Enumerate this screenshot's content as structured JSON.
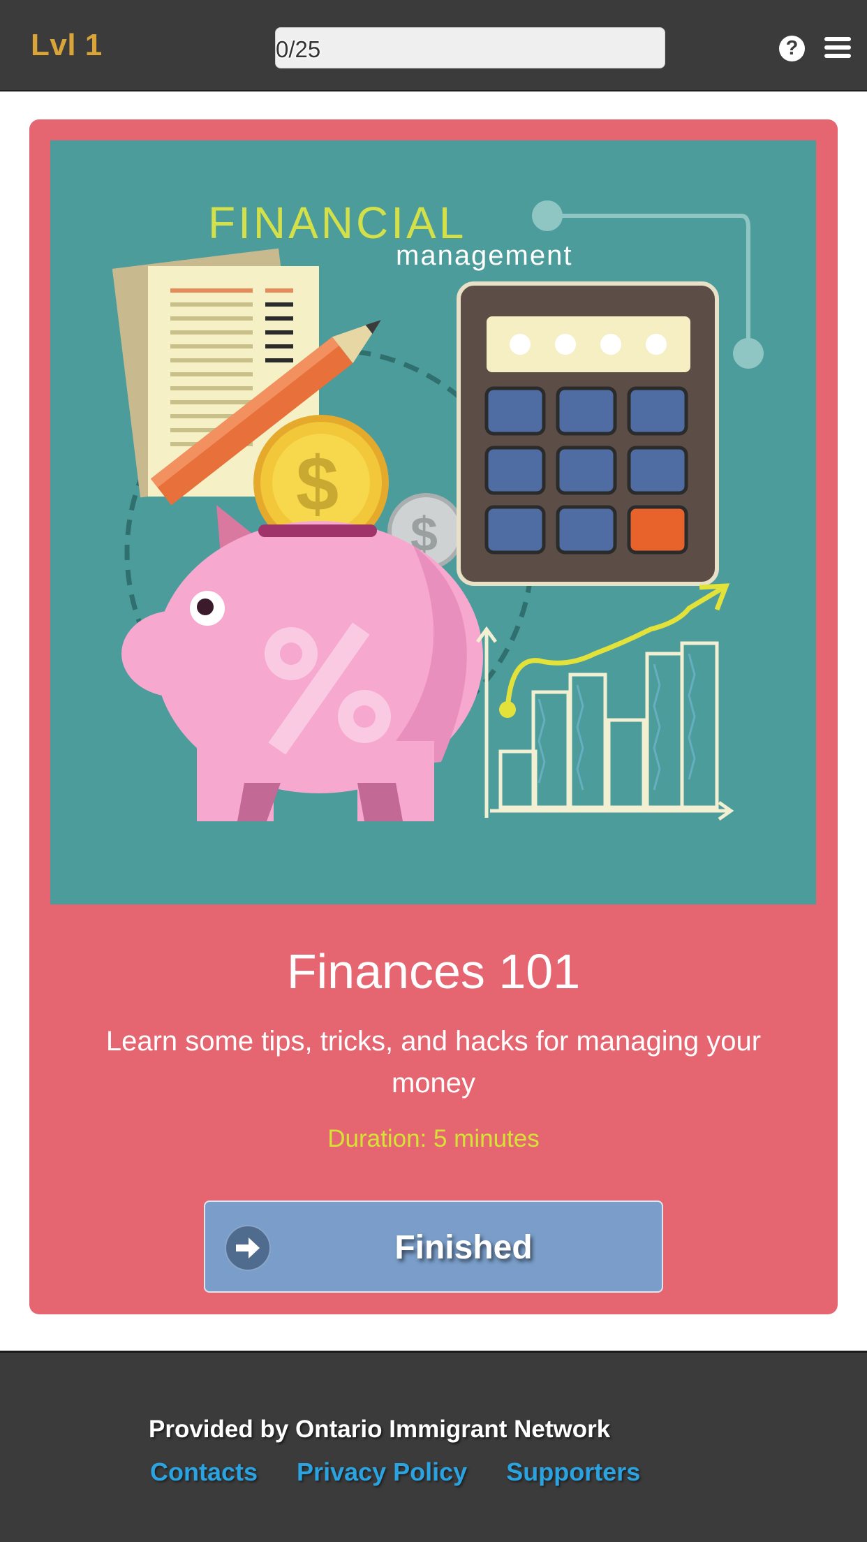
{
  "header": {
    "level_label": "Lvl 1",
    "progress_text": "0/25",
    "progress_fraction": 0.0,
    "help_icon": "question-circle-icon",
    "menu_icon": "hamburger-menu-icon"
  },
  "card": {
    "illustration": {
      "heading": "FINANCIAL",
      "subheading": "management"
    },
    "title": "Finances 101",
    "description": "Learn some tips, tricks, and hacks for managing your money",
    "duration": "Duration: 5 minutes",
    "button": {
      "label": "Finished",
      "icon": "arrow-right-circle-icon"
    }
  },
  "footer": {
    "provided_by": "Provided by Ontario Immigrant Network",
    "links": [
      "Contacts",
      "Privacy Policy",
      "Supporters"
    ]
  },
  "colors": {
    "header_bg": "#3b3b3b",
    "level_text": "#d9a43a",
    "card_bg": "#e56670",
    "illustration_bg": "#4b9c9b",
    "duration_text": "#d6e235",
    "button_bg": "#7a9ec9",
    "link": "#2aa3e0"
  }
}
